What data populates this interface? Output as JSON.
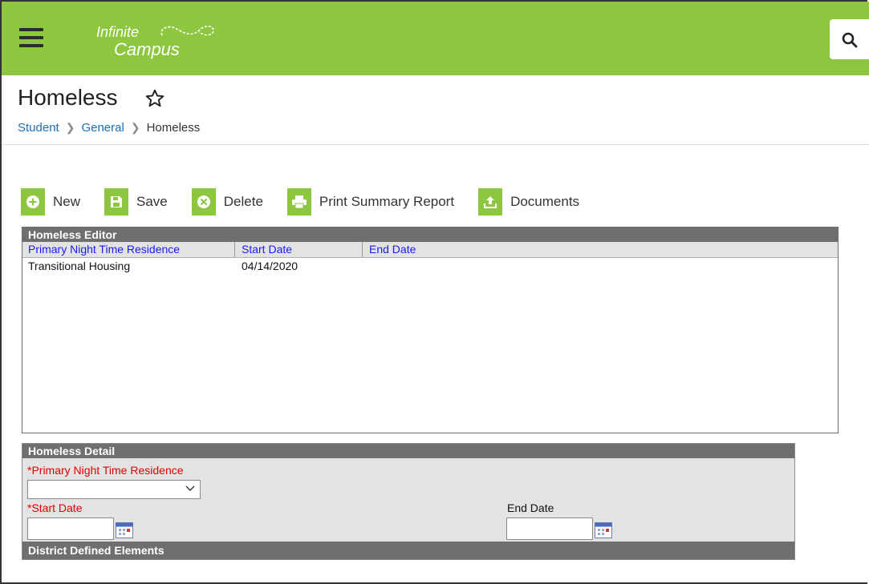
{
  "app": {
    "logo_line1": "Infinite",
    "logo_line2": "Campus"
  },
  "page": {
    "title": "Homeless"
  },
  "breadcrumb": [
    {
      "label": "Student"
    },
    {
      "label": "General"
    },
    {
      "label": "Homeless"
    }
  ],
  "toolbar": {
    "new_label": "New",
    "save_label": "Save",
    "delete_label": "Delete",
    "print_label": "Print Summary Report",
    "documents_label": "Documents"
  },
  "editor": {
    "title": "Homeless Editor",
    "columns": [
      "Primary Night Time Residence",
      "Start Date",
      "End Date"
    ],
    "rows": [
      [
        "Transitional Housing",
        "04/14/2020",
        ""
      ]
    ]
  },
  "detail": {
    "title": "Homeless Detail",
    "residence_label": "*Primary Night Time Residence",
    "residence_value": "",
    "start_label": "*Start Date",
    "start_value": "",
    "end_label": "End Date",
    "end_value": "",
    "district_header": "District Defined Elements"
  },
  "colors": {
    "brand_green": "#8dc63f",
    "panel_header": "#6f6f6f",
    "link_blue": "#1a6fb5",
    "required_red": "#e00000"
  }
}
